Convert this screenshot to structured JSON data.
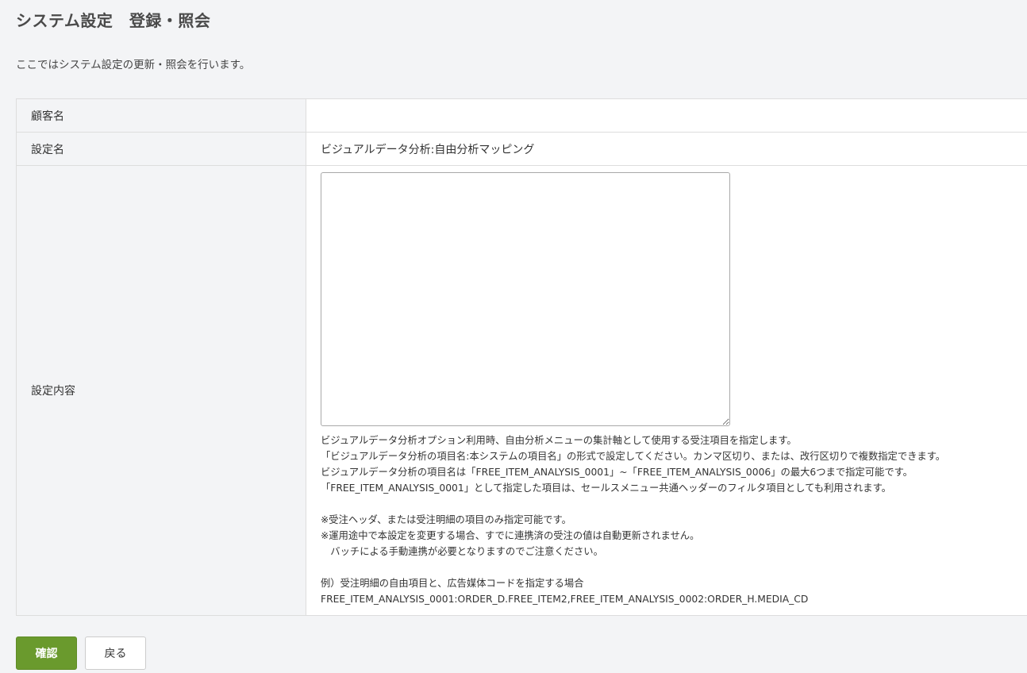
{
  "page": {
    "title": "システム設定　登録・照会",
    "description": "ここではシステム設定の更新・照会を行います。"
  },
  "form": {
    "customer_label": "顧客名",
    "customer_value": "",
    "setting_name_label": "設定名",
    "setting_name_value": "ビジュアルデータ分析:自由分析マッピング",
    "setting_content_label": "設定内容",
    "setting_content_value": "",
    "help_lines": [
      "ビジュアルデータ分析オプション利用時、自由分析メニューの集計軸として使用する受注項目を指定します。",
      "「ビジュアルデータ分析の項目名:本システムの項目名」の形式で設定してください。カンマ区切り、または、改行区切りで複数指定できます。",
      "ビジュアルデータ分析の項目名は「FREE_ITEM_ANALYSIS_0001」~「FREE_ITEM_ANALYSIS_0006」の最大6つまで指定可能です。",
      "「FREE_ITEM_ANALYSIS_0001」として指定した項目は、セールスメニュー共通ヘッダーのフィルタ項目としても利用されます。",
      "",
      "※受注ヘッダ、または受注明細の項目のみ指定可能です。",
      "※運用途中で本設定を変更する場合、すでに連携済の受注の値は自動更新されません。",
      "　バッチによる手動連携が必要となりますのでご注意ください。",
      "",
      "例）受注明細の自由項目と、広告媒体コードを指定する場合",
      "FREE_ITEM_ANALYSIS_0001:ORDER_D.FREE_ITEM2,FREE_ITEM_ANALYSIS_0002:ORDER_H.MEDIA_CD"
    ]
  },
  "buttons": {
    "confirm_label": "確認",
    "back_label": "戻る"
  },
  "colors": {
    "confirm_button": "#6a9a2d",
    "page_background": "#f3f4f6"
  }
}
